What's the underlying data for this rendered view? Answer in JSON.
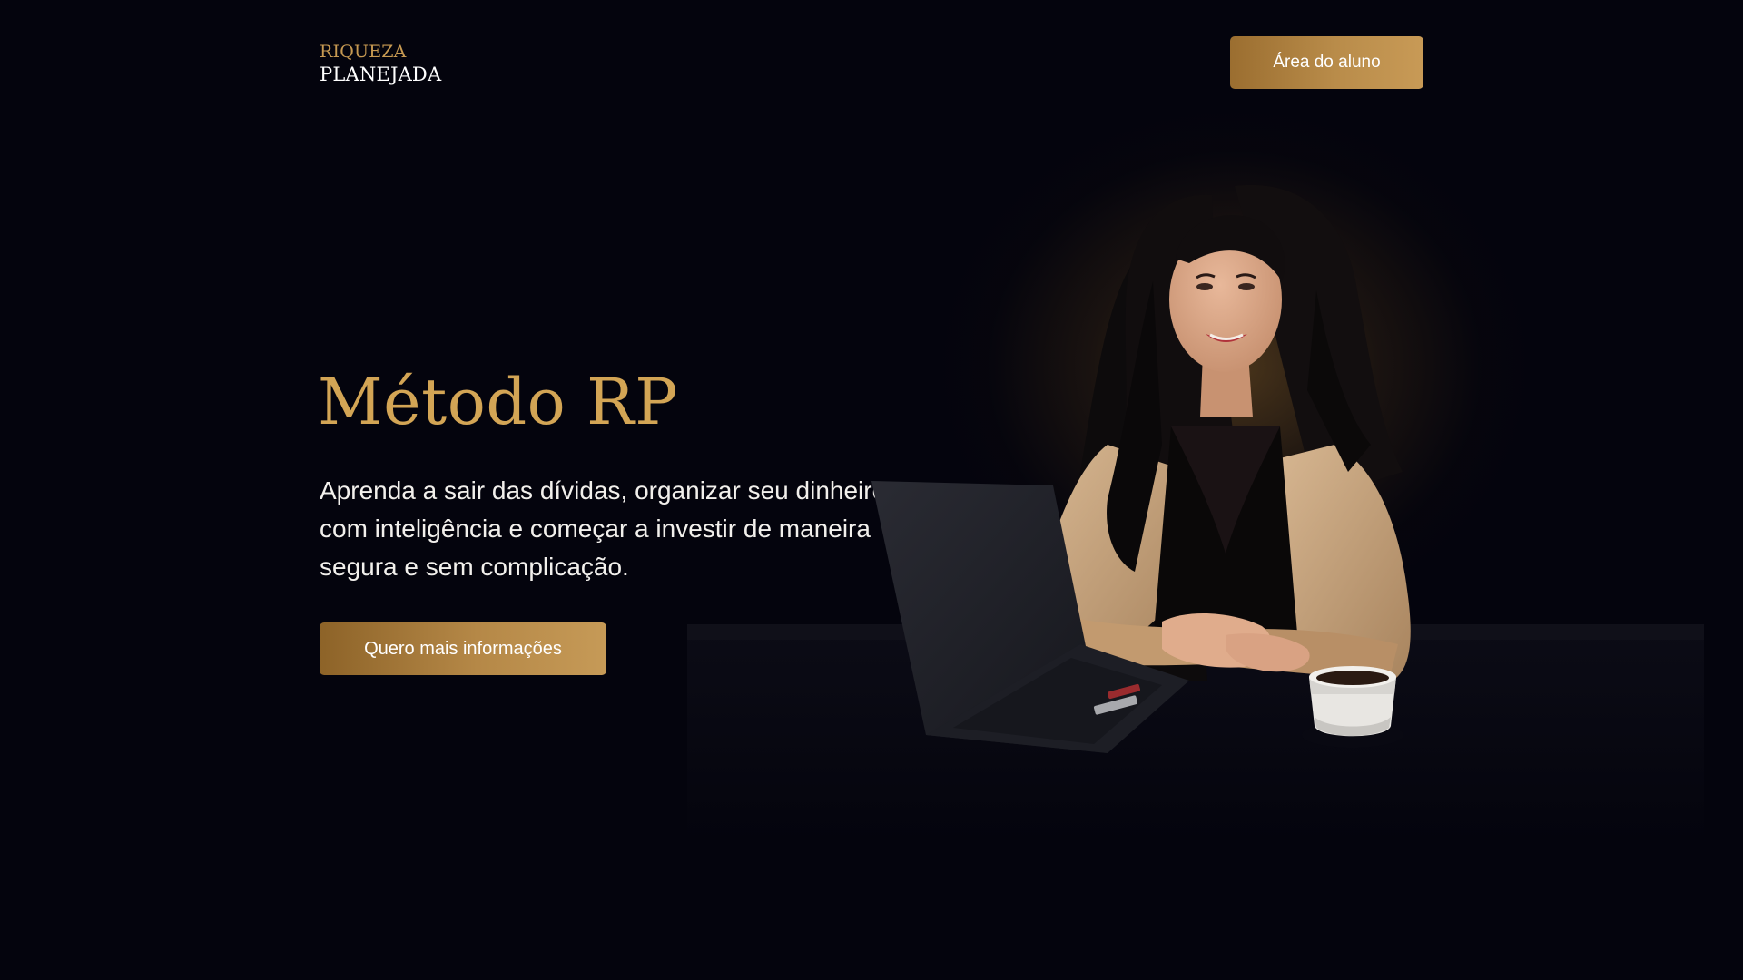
{
  "header": {
    "logo_line1": "RIQUEZA",
    "logo_line2": "PLANEJADA",
    "student_area_label": "Área do aluno"
  },
  "hero": {
    "title": "Método RP",
    "subtitle": "Aprenda a sair das dívidas, organizar seu dinheiro com inteligência e começar a investir de maneira segura e sem complicação.",
    "cta_label": "Quero mais informações"
  },
  "photo": {
    "subject": "portrait-woman-laptop-coffee-icon"
  },
  "colors": {
    "background": "#04040d",
    "gold_accent": "#d3a555",
    "button_gold": "#b58847"
  }
}
